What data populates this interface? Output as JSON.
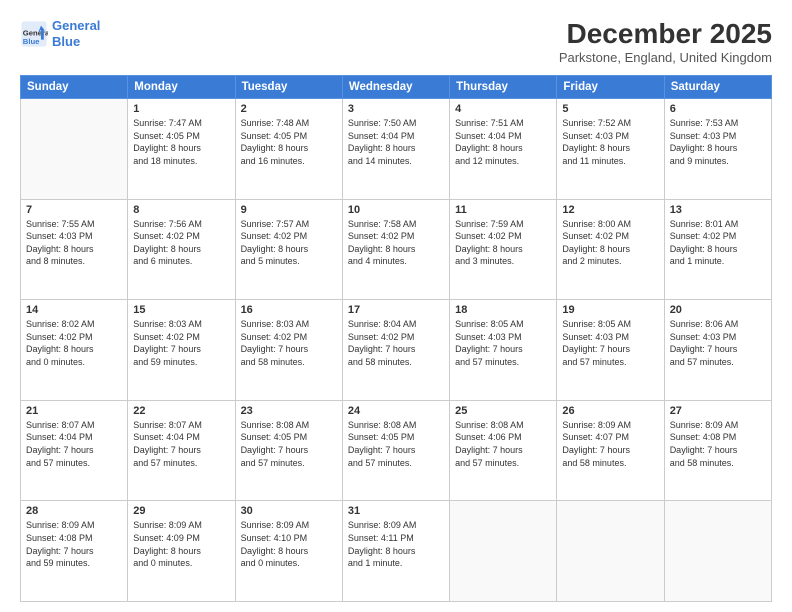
{
  "header": {
    "logo_line1": "General",
    "logo_line2": "Blue",
    "month_title": "December 2025",
    "subtitle": "Parkstone, England, United Kingdom"
  },
  "days_of_week": [
    "Sunday",
    "Monday",
    "Tuesday",
    "Wednesday",
    "Thursday",
    "Friday",
    "Saturday"
  ],
  "weeks": [
    [
      {
        "day": "",
        "info": ""
      },
      {
        "day": "1",
        "info": "Sunrise: 7:47 AM\nSunset: 4:05 PM\nDaylight: 8 hours\nand 18 minutes."
      },
      {
        "day": "2",
        "info": "Sunrise: 7:48 AM\nSunset: 4:05 PM\nDaylight: 8 hours\nand 16 minutes."
      },
      {
        "day": "3",
        "info": "Sunrise: 7:50 AM\nSunset: 4:04 PM\nDaylight: 8 hours\nand 14 minutes."
      },
      {
        "day": "4",
        "info": "Sunrise: 7:51 AM\nSunset: 4:04 PM\nDaylight: 8 hours\nand 12 minutes."
      },
      {
        "day": "5",
        "info": "Sunrise: 7:52 AM\nSunset: 4:03 PM\nDaylight: 8 hours\nand 11 minutes."
      },
      {
        "day": "6",
        "info": "Sunrise: 7:53 AM\nSunset: 4:03 PM\nDaylight: 8 hours\nand 9 minutes."
      }
    ],
    [
      {
        "day": "7",
        "info": "Sunrise: 7:55 AM\nSunset: 4:03 PM\nDaylight: 8 hours\nand 8 minutes."
      },
      {
        "day": "8",
        "info": "Sunrise: 7:56 AM\nSunset: 4:02 PM\nDaylight: 8 hours\nand 6 minutes."
      },
      {
        "day": "9",
        "info": "Sunrise: 7:57 AM\nSunset: 4:02 PM\nDaylight: 8 hours\nand 5 minutes."
      },
      {
        "day": "10",
        "info": "Sunrise: 7:58 AM\nSunset: 4:02 PM\nDaylight: 8 hours\nand 4 minutes."
      },
      {
        "day": "11",
        "info": "Sunrise: 7:59 AM\nSunset: 4:02 PM\nDaylight: 8 hours\nand 3 minutes."
      },
      {
        "day": "12",
        "info": "Sunrise: 8:00 AM\nSunset: 4:02 PM\nDaylight: 8 hours\nand 2 minutes."
      },
      {
        "day": "13",
        "info": "Sunrise: 8:01 AM\nSunset: 4:02 PM\nDaylight: 8 hours\nand 1 minute."
      }
    ],
    [
      {
        "day": "14",
        "info": "Sunrise: 8:02 AM\nSunset: 4:02 PM\nDaylight: 8 hours\nand 0 minutes."
      },
      {
        "day": "15",
        "info": "Sunrise: 8:03 AM\nSunset: 4:02 PM\nDaylight: 7 hours\nand 59 minutes."
      },
      {
        "day": "16",
        "info": "Sunrise: 8:03 AM\nSunset: 4:02 PM\nDaylight: 7 hours\nand 58 minutes."
      },
      {
        "day": "17",
        "info": "Sunrise: 8:04 AM\nSunset: 4:02 PM\nDaylight: 7 hours\nand 58 minutes."
      },
      {
        "day": "18",
        "info": "Sunrise: 8:05 AM\nSunset: 4:03 PM\nDaylight: 7 hours\nand 57 minutes."
      },
      {
        "day": "19",
        "info": "Sunrise: 8:05 AM\nSunset: 4:03 PM\nDaylight: 7 hours\nand 57 minutes."
      },
      {
        "day": "20",
        "info": "Sunrise: 8:06 AM\nSunset: 4:03 PM\nDaylight: 7 hours\nand 57 minutes."
      }
    ],
    [
      {
        "day": "21",
        "info": "Sunrise: 8:07 AM\nSunset: 4:04 PM\nDaylight: 7 hours\nand 57 minutes."
      },
      {
        "day": "22",
        "info": "Sunrise: 8:07 AM\nSunset: 4:04 PM\nDaylight: 7 hours\nand 57 minutes."
      },
      {
        "day": "23",
        "info": "Sunrise: 8:08 AM\nSunset: 4:05 PM\nDaylight: 7 hours\nand 57 minutes."
      },
      {
        "day": "24",
        "info": "Sunrise: 8:08 AM\nSunset: 4:05 PM\nDaylight: 7 hours\nand 57 minutes."
      },
      {
        "day": "25",
        "info": "Sunrise: 8:08 AM\nSunset: 4:06 PM\nDaylight: 7 hours\nand 57 minutes."
      },
      {
        "day": "26",
        "info": "Sunrise: 8:09 AM\nSunset: 4:07 PM\nDaylight: 7 hours\nand 58 minutes."
      },
      {
        "day": "27",
        "info": "Sunrise: 8:09 AM\nSunset: 4:08 PM\nDaylight: 7 hours\nand 58 minutes."
      }
    ],
    [
      {
        "day": "28",
        "info": "Sunrise: 8:09 AM\nSunset: 4:08 PM\nDaylight: 7 hours\nand 59 minutes."
      },
      {
        "day": "29",
        "info": "Sunrise: 8:09 AM\nSunset: 4:09 PM\nDaylight: 8 hours\nand 0 minutes."
      },
      {
        "day": "30",
        "info": "Sunrise: 8:09 AM\nSunset: 4:10 PM\nDaylight: 8 hours\nand 0 minutes."
      },
      {
        "day": "31",
        "info": "Sunrise: 8:09 AM\nSunset: 4:11 PM\nDaylight: 8 hours\nand 1 minute."
      },
      {
        "day": "",
        "info": ""
      },
      {
        "day": "",
        "info": ""
      },
      {
        "day": "",
        "info": ""
      }
    ]
  ]
}
